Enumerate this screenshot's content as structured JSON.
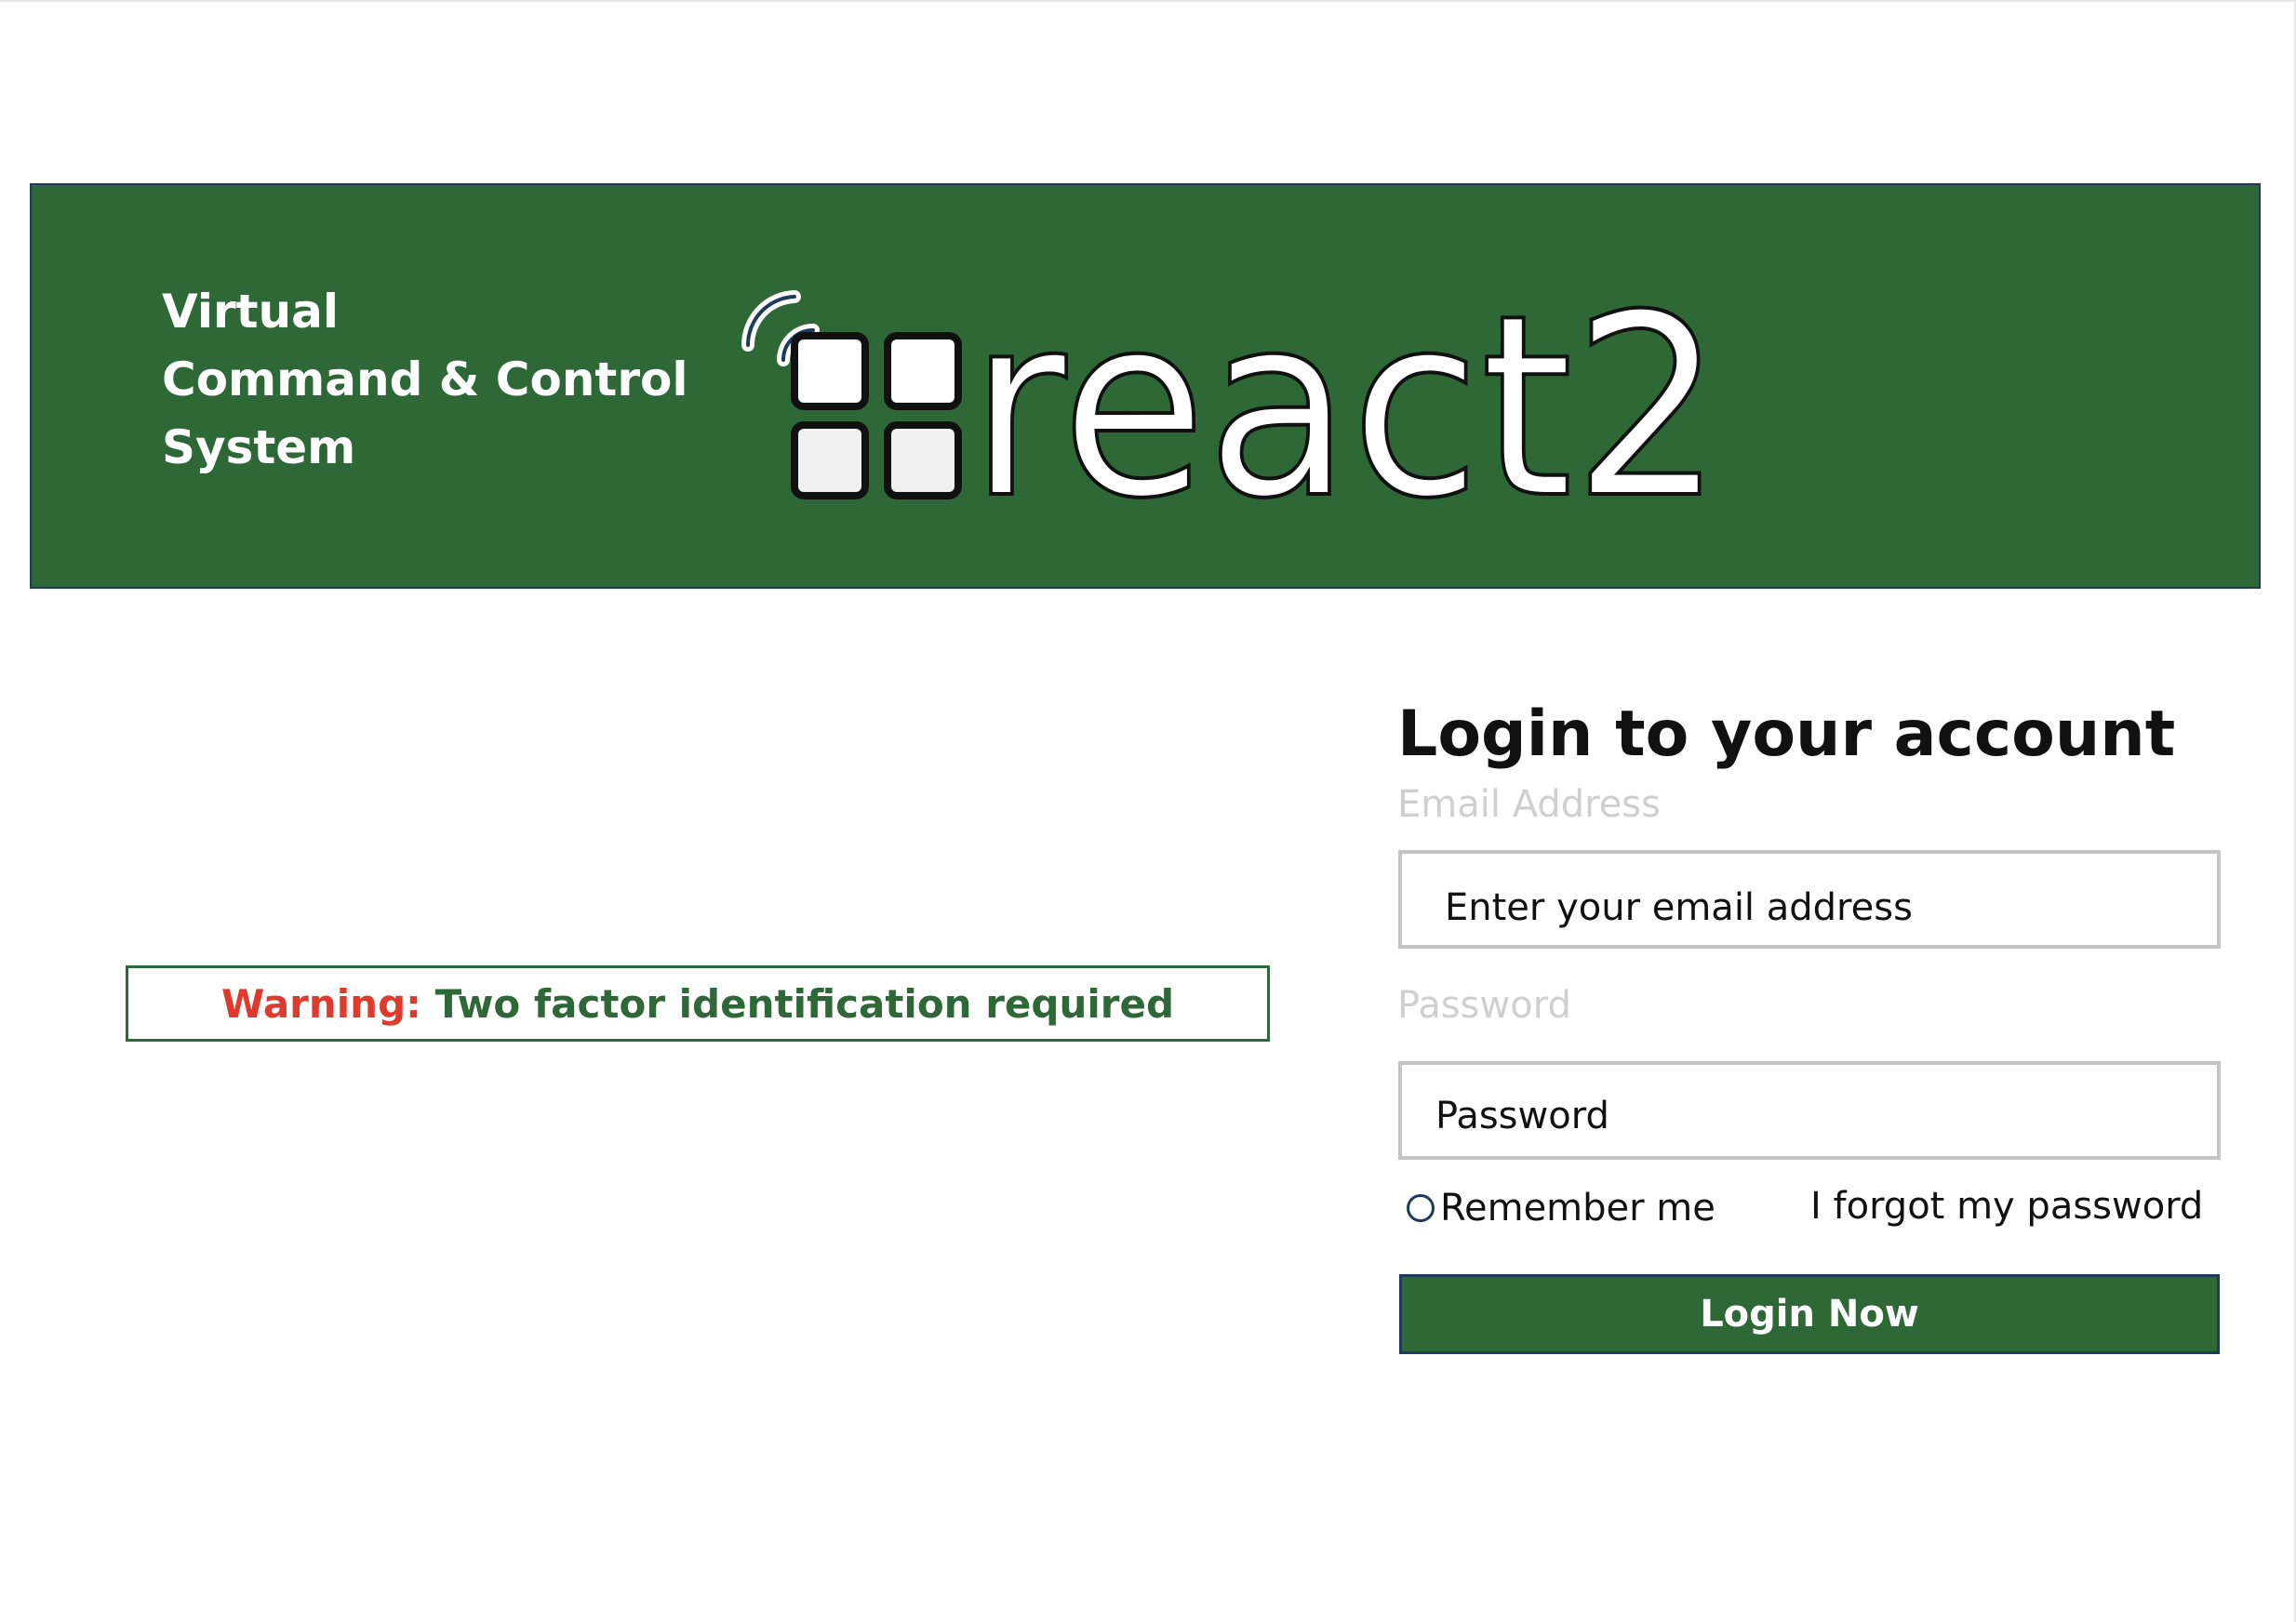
{
  "header": {
    "tagline_lines": [
      "Virtual",
      "Command & Control",
      "System"
    ],
    "logo_text": "react2",
    "logo_icon": "signal-grid-icon"
  },
  "warning": {
    "label": "Warning:",
    "text": "Two factor identification required"
  },
  "login": {
    "title": "Login to your account",
    "email_label": "Email Address",
    "email_placeholder": "Enter your email address",
    "email_value": "",
    "password_label": "Password",
    "password_placeholder": "Password",
    "password_value": "",
    "remember_label": "Remember me",
    "remember_checked": false,
    "forgot_label": "I forgot my password",
    "submit_label": "Login Now"
  },
  "colors": {
    "brand_green": "#2d6836",
    "warning_red": "#e03a2c",
    "border_navy": "#1f3a5c",
    "input_border": "#c4c4c4",
    "label_gray": "#cfcfcf"
  }
}
